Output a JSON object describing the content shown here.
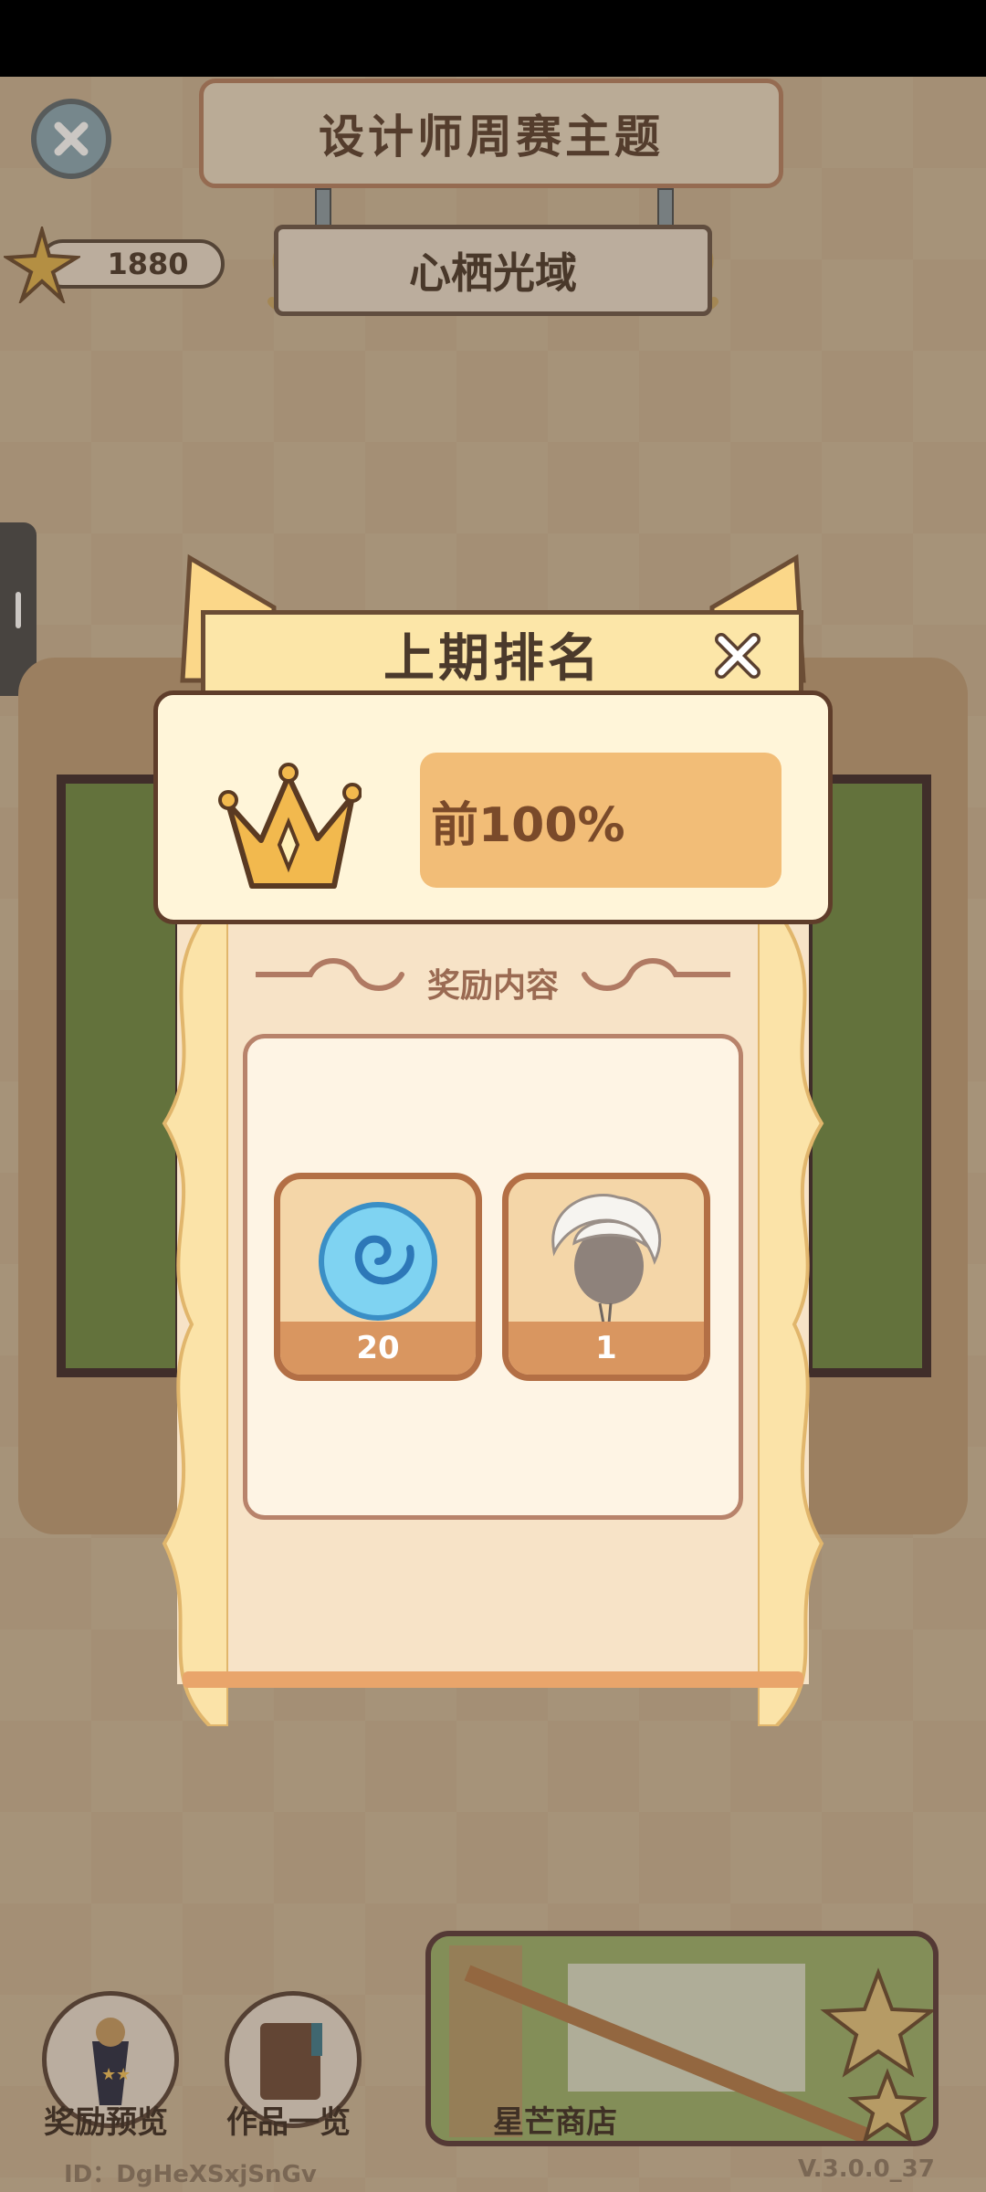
{
  "header": {
    "title": "设计师周赛主题",
    "theme_name": "心栖光域",
    "score": "1880"
  },
  "popup": {
    "title": "上期排名",
    "rank_label": "前100%",
    "reward_header": "奖励内容",
    "rewards": [
      {
        "icon": "blue-swirl-icon",
        "count": "20"
      },
      {
        "icon": "white-hair-avatar-icon",
        "count": "1"
      }
    ]
  },
  "bottom": {
    "reward_preview_label": "奖励预览",
    "works_list_label": "作品一览",
    "shop_label": "星芒商店",
    "user_id": "ID：DgHeXSxjSnGv",
    "version": "V.3.0.0_37"
  },
  "colors": {
    "rank_box": "#f2bd77",
    "popup_border": "#5f3d2a",
    "reward_count_bg": "#d99660"
  }
}
